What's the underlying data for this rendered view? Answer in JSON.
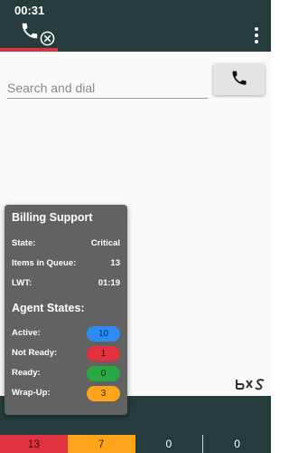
{
  "status_bar": {
    "time": "00:31"
  },
  "header": {
    "icons": [
      "phone-icon",
      "close-circle-icon",
      "more-vertical-icon"
    ]
  },
  "dialer": {
    "search_placeholder": "Search and dial",
    "search_value": "",
    "dial_icon": "phone-icon"
  },
  "queue_popup": {
    "title": "Billing Support",
    "info": [
      {
        "label": "State:",
        "value": "Critical"
      },
      {
        "label": "Items in Queue:",
        "value": "13"
      },
      {
        "label": "LWT:",
        "value": "01:19"
      }
    ],
    "agent_states_title": "Agent States:",
    "agent_states": [
      {
        "label": "Active:",
        "value": "10",
        "color": "#2e8bf5",
        "text_color": "#0b2a55"
      },
      {
        "label": "Not Ready:",
        "value": "1",
        "color": "#e0323f",
        "text_color": "#3a0a0a"
      },
      {
        "label": "Ready:",
        "value": "0",
        "color": "#28a745",
        "text_color": "#0a2a10"
      },
      {
        "label": "Wrap-Up:",
        "value": "3",
        "color": "#ffa41b",
        "text_color": "#3a2600"
      }
    ]
  },
  "bottom_stats": [
    {
      "value": "13",
      "color": "#e0323f"
    },
    {
      "value": "7",
      "color": "#ffa41b"
    },
    {
      "value": "0",
      "color": "#263c3c"
    },
    {
      "value": "0",
      "color": "#263c3c"
    }
  ],
  "colors": {
    "header_bg": "#263c3c",
    "accent": "#e0323f",
    "popup_bg": "#626262"
  }
}
